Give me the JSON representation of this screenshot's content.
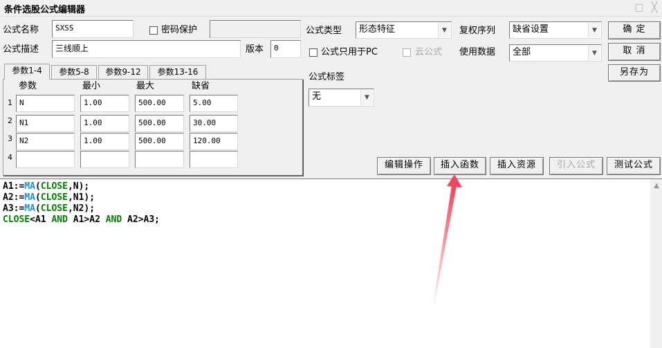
{
  "window": {
    "title": "条件选股公式编辑器",
    "minimize_glyph": "□",
    "close_glyph": "╳"
  },
  "form": {
    "name_label": "公式名称",
    "name_value": "SXSS",
    "password_label": "密码保护",
    "password_value": "",
    "desc_label": "公式描述",
    "desc_value": "三线顺上",
    "version_label": "版本",
    "version_value": "0",
    "type_label": "公式类型",
    "type_value": "形态特征",
    "rights_label": "复权序列",
    "rights_value": "缺省设置",
    "pc_only_label": "公式只用于PC",
    "cloud_label": "云公式",
    "data_label": "使用数据",
    "data_value": "全部",
    "tag_label": "公式标签",
    "tag_value": "无"
  },
  "buttons": {
    "ok": "确 定",
    "cancel": "取 消",
    "save_as": "另存为",
    "edit_ops": "编辑操作",
    "insert_func": "插入函数",
    "insert_res": "插入资源",
    "import_formula": "引入公式",
    "test_formula": "测试公式"
  },
  "tabs": [
    "参数1-4",
    "参数5-8",
    "参数9-12",
    "参数13-16"
  ],
  "params": {
    "headers": [
      "参数",
      "最小",
      "最大",
      "缺省"
    ],
    "rows": [
      {
        "num": "1",
        "name": "N",
        "min": "1.00",
        "max": "500.00",
        "def": "5.00"
      },
      {
        "num": "2",
        "name": "N1",
        "min": "1.00",
        "max": "500.00",
        "def": "30.00"
      },
      {
        "num": "3",
        "name": "N2",
        "min": "1.00",
        "max": "500.00",
        "def": "120.00"
      },
      {
        "num": "4",
        "name": "",
        "min": "",
        "max": "",
        "def": ""
      }
    ]
  },
  "code": {
    "line1": {
      "a": "A1:=",
      "fn": "MA",
      "b": "(",
      "kw": "CLOSE",
      "c": ",N);"
    },
    "line2": {
      "a": "A2:=",
      "fn": "MA",
      "b": "(",
      "kw": "CLOSE",
      "c": ",N1);"
    },
    "line3": {
      "a": "A3:=",
      "fn": "MA",
      "b": "(",
      "kw": "CLOSE",
      "c": ",N2);"
    },
    "line4": {
      "kw1": "CLOSE",
      "a": "<A1 ",
      "kw2": "AND",
      "b": " A1>A2 ",
      "kw3": "AND",
      "c": " A2>A3;"
    }
  },
  "annotation": {
    "arrow_color": "#f0455a"
  },
  "colors": {
    "green_keyword": "#008000",
    "blue_function": "#1f8dd6"
  }
}
